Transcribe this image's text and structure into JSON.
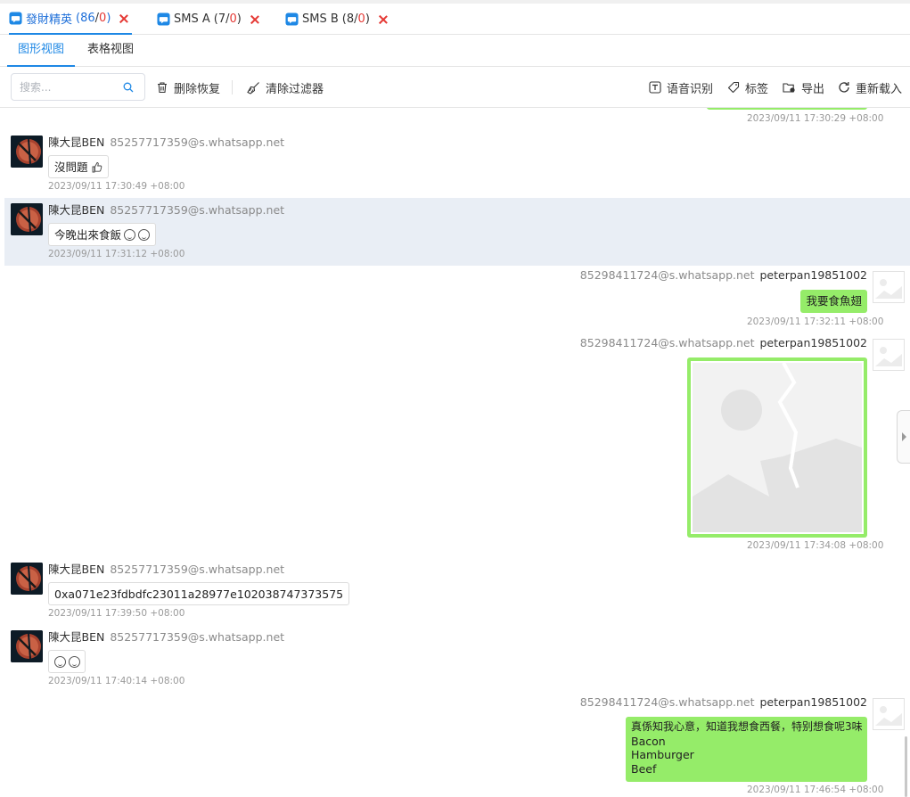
{
  "tabs": [
    {
      "title": "發財精英",
      "count": "86",
      "sep": "/",
      "unread": "0",
      "active": true
    },
    {
      "title": "SMS A",
      "count": "7",
      "sep": "/",
      "unread": "0",
      "active": false
    },
    {
      "title": "SMS B",
      "count": "8",
      "sep": "/",
      "unread": "0",
      "active": false
    }
  ],
  "view_tabs": {
    "graphic": "图形视图",
    "table": "表格视图"
  },
  "toolbar": {
    "search_placeholder": "搜索...",
    "delete_restore": "删除恢复",
    "clear_filter": "清除过滤器",
    "speech_recognition": "语音识别",
    "tags": "标签",
    "export": "导出",
    "reload": "重新载入"
  },
  "messages": {
    "m0": {
      "time": "2023/09/11 17:30:29 +08:00"
    },
    "m1": {
      "name": "陳大昆BEN",
      "jid": "85257717359@s.whatsapp.net",
      "text": "沒問題",
      "emoji": "thumbs-up-icon",
      "time": "2023/09/11 17:30:49 +08:00"
    },
    "m2": {
      "name": "陳大昆BEN",
      "jid": "85257717359@s.whatsapp.net",
      "text": "今晚出來食飯",
      "emoji": "grinning-face-icon",
      "time": "2023/09/11 17:31:12 +08:00"
    },
    "m3": {
      "name": "peterpan19851002",
      "jid": "85298411724@s.whatsapp.net",
      "text": "我要食魚翅",
      "time": "2023/09/11 17:32:11 +08:00"
    },
    "m4": {
      "name": "peterpan19851002",
      "jid": "85298411724@s.whatsapp.net",
      "image": "broken-image-icon",
      "time": "2023/09/11 17:34:08 +08:00"
    },
    "m5": {
      "name": "陳大昆BEN",
      "jid": "85257717359@s.whatsapp.net",
      "text": "0xa071e23fdbdfc23011a28977e102038747373575",
      "time": "2023/09/11 17:39:50 +08:00"
    },
    "m6": {
      "name": "陳大昆BEN",
      "jid": "85257717359@s.whatsapp.net",
      "emoji": "face-emojis-icon",
      "time": "2023/09/11 17:40:14 +08:00"
    },
    "m7": {
      "name": "peterpan19851002",
      "jid": "85298411724@s.whatsapp.net",
      "lines": [
        "真係知我心意，知道我想食西餐，特别想食呢3味",
        "Bacon",
        "Hamburger",
        "Beef"
      ],
      "time": "2023/09/11 17:46:54 +08:00"
    }
  },
  "colors": {
    "accent": "#1e88e5",
    "bubble_out": "#95ec69",
    "selected_row": "#e9eef5",
    "close_red": "#e53935"
  }
}
